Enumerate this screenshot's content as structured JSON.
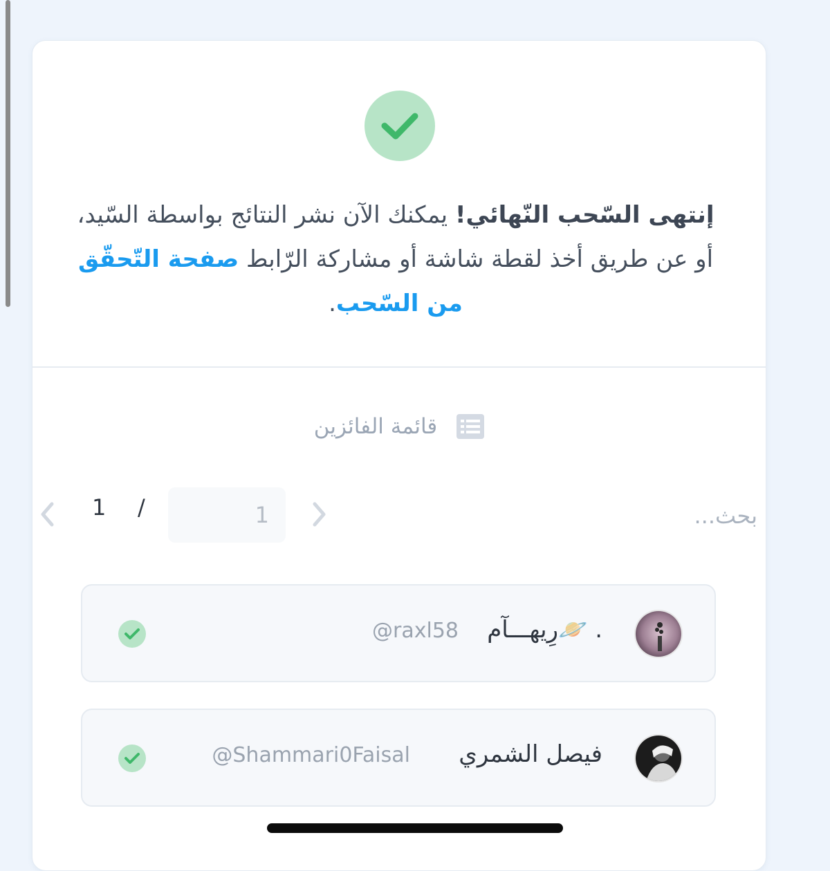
{
  "result": {
    "message_bold": "إنتهى السّحب النّهائي!",
    "message_body": " يمكنك الآن نشر النتائج بواسطة السّيد، أو عن طريق أخذ لقطة شاشة أو مشاركة الرّابط ",
    "message_link": "صفحة التّحقّق من السّحب",
    "message_end": "."
  },
  "winners_section": {
    "title": "قائمة الفائزين",
    "icon": "list-icon"
  },
  "search": {
    "placeholder": "بحث..."
  },
  "pagination": {
    "current": "1",
    "separator": "/",
    "total": "1"
  },
  "winners": [
    {
      "name": "رِيهـــآم🪐 .",
      "handle": "@raxl58",
      "status_icon": "check-icon"
    },
    {
      "name": "فيصل الشمري",
      "handle": "@Shammari0Faisal",
      "status_icon": "check-icon"
    }
  ],
  "colors": {
    "accent_link": "#1a9bef",
    "success_bg": "#b7e4c7",
    "success_check": "#3fb86a",
    "page_bg": "#eef4fc"
  }
}
